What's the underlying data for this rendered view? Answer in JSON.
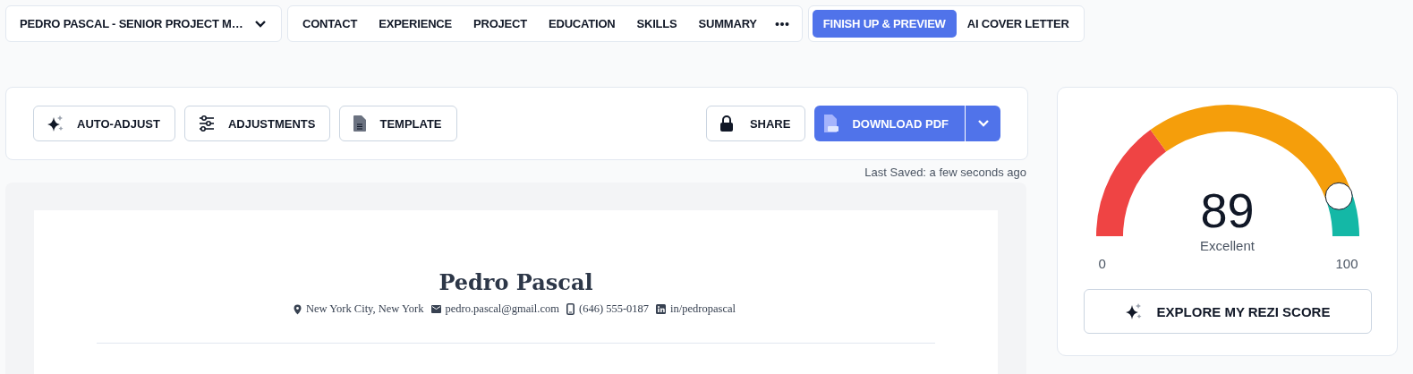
{
  "resume_selector": {
    "label": "PEDRO PASCAL - SENIOR PROJECT M…"
  },
  "sections": [
    {
      "label": "CONTACT",
      "selected": false
    },
    {
      "label": "EXPERIENCE",
      "selected": false
    },
    {
      "label": "PROJECT",
      "selected": false
    },
    {
      "label": "EDUCATION",
      "selected": false
    },
    {
      "label": "SKILLS",
      "selected": false
    },
    {
      "label": "SUMMARY",
      "selected": false
    }
  ],
  "steps": [
    {
      "label": "FINISH UP & PREVIEW",
      "selected": true
    },
    {
      "label": "AI COVER LETTER",
      "selected": false
    }
  ],
  "toolbar": {
    "buttons": [
      {
        "kind": "sparkle",
        "label": "AUTO-ADJUST"
      },
      {
        "kind": "sliders",
        "label": "ADJUSTMENTS"
      },
      {
        "kind": "document",
        "label": "TEMPLATE"
      }
    ],
    "share": "SHARE",
    "download": "DOWNLOAD PDF"
  },
  "last_saved": "Last Saved: a few seconds ago",
  "resume": {
    "name": "Pedro Pascal",
    "contacts": [
      {
        "kind": "location",
        "text": "New York City,  New York"
      },
      {
        "kind": "email",
        "text": "pedro.pascal@gmail.com"
      },
      {
        "kind": "phone",
        "text": "(646) 555-0187"
      },
      {
        "kind": "linkedin",
        "text": "in/pedropascal"
      }
    ]
  },
  "score": {
    "value": "89",
    "rating": "Excellent",
    "min": "0",
    "max": "100",
    "level": 0.89,
    "button": "EXPLORE MY REZI SCORE"
  }
}
